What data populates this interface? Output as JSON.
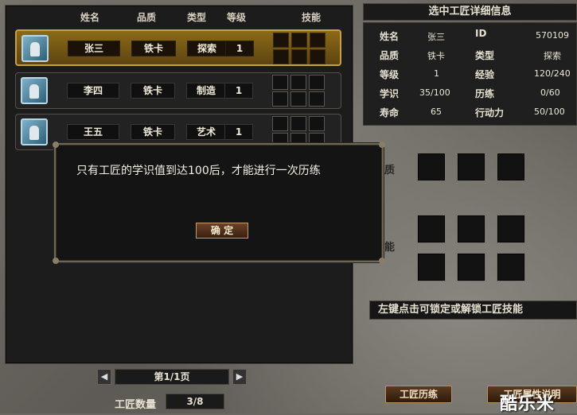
{
  "list_header": {
    "name": "姓名",
    "quality": "品质",
    "type": "类型",
    "level": "等级",
    "skills": "技能"
  },
  "craftsmen": [
    {
      "name": "张三",
      "quality": "铁卡",
      "type": "探索",
      "level": "1"
    },
    {
      "name": "李四",
      "quality": "铁卡",
      "type": "制造",
      "level": "1"
    },
    {
      "name": "王五",
      "quality": "铁卡",
      "type": "艺术",
      "level": "1"
    }
  ],
  "pager": {
    "prev": "◀",
    "page": "第1/1页",
    "next": "▶"
  },
  "count": {
    "label": "工匠数量",
    "value": "3/8"
  },
  "detail": {
    "title": "选中工匠详细信息",
    "name_label": "姓名",
    "name_value": "张三",
    "id_label": "ID",
    "id_value": "570109",
    "quality_label": "品质",
    "quality_value": "铁卡",
    "type_label": "类型",
    "type_value": "探索",
    "level_label": "等级",
    "level_value": "1",
    "exp_label": "经验",
    "exp_value": "120/240",
    "knowledge_label": "学识",
    "knowledge_value": "35/100",
    "train_label": "历练",
    "train_value": "0/60",
    "life_label": "寿命",
    "life_value": "65",
    "action_label": "行动力",
    "action_value": "50/100"
  },
  "side_labels": {
    "trait": "特质",
    "skill": "技能"
  },
  "hint": "左键点击可锁定或解锁工匠技能",
  "buttons": {
    "train": "工匠历练",
    "attr_help": "工匠属性说明"
  },
  "watermark": "酷乐米",
  "modal": {
    "message": "只有工匠的学识值到达100后，才能进行一次历练",
    "ok": "确  定"
  }
}
